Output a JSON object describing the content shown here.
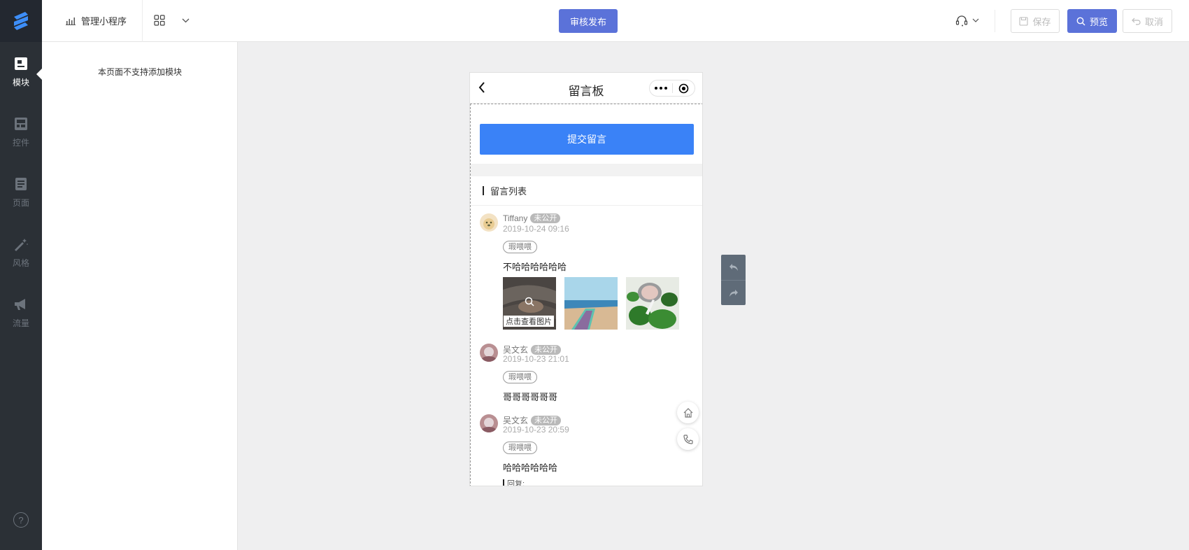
{
  "nav": {
    "items": [
      {
        "label": "模块",
        "icon": "module-icon",
        "active": true
      },
      {
        "label": "控件",
        "icon": "widget-icon",
        "active": false
      },
      {
        "label": "页面",
        "icon": "page-icon",
        "active": false
      },
      {
        "label": "风格",
        "icon": "style-wand-icon",
        "active": false
      },
      {
        "label": "流量",
        "icon": "megaphone-icon",
        "active": false
      }
    ],
    "help_symbol": "?"
  },
  "topbar": {
    "manage_label": "管理小程序",
    "review_publish_label": "审核发布",
    "save_label": "保存",
    "preview_label": "预览",
    "cancel_label": "取消"
  },
  "sidepanel": {
    "notice": "本页面不支持添加模块"
  },
  "phone": {
    "title": "留言板",
    "submit_label": "提交留言",
    "list_title": "留言列表",
    "messages": [
      {
        "name": "Tiffany",
        "tag": "未公开",
        "time": "2019-10-24 09:16",
        "label": "瑕喂喂",
        "text": "不哈哈哈哈哈哈",
        "image_tip": "点击查看图片"
      },
      {
        "name": "吴文玄",
        "tag": "未公开",
        "time": "2019-10-23 21:01",
        "label": "瑕喂喂",
        "text": "哥哥哥哥哥哥"
      },
      {
        "name": "吴文玄",
        "tag": "未公开",
        "time": "2019-10-23 20:59",
        "label": "瑕喂喂",
        "text": "哈哈哈哈哈哈",
        "reply_label": "回复:"
      }
    ]
  },
  "colors": {
    "primary": "#5b72d9",
    "submit": "#3a82f7",
    "nav_bg": "#2b3036"
  }
}
